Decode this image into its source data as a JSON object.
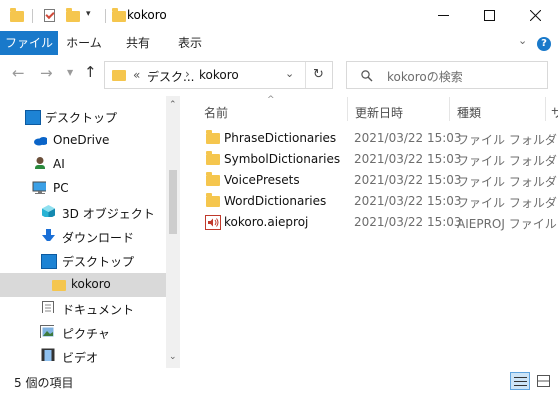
{
  "window": {
    "title": "kokoro"
  },
  "ribbon": {
    "tabs": [
      "ファイル",
      "ホーム",
      "共有",
      "表示"
    ]
  },
  "address": {
    "overflow": "«",
    "crumbs": [
      "デスク...",
      "kokoro"
    ]
  },
  "search": {
    "placeholder": "kokoroの検索"
  },
  "nav": {
    "items": [
      {
        "label": "デスクトップ",
        "icon": "desktop-icon"
      },
      {
        "label": "OneDrive",
        "icon": "cloud-icon"
      },
      {
        "label": "AI",
        "icon": "user-icon"
      },
      {
        "label": "PC",
        "icon": "pc-icon"
      },
      {
        "label": "3D オブジェクト",
        "icon": "cube-icon"
      },
      {
        "label": "ダウンロード",
        "icon": "download-arrow-icon"
      },
      {
        "label": "デスクトップ",
        "icon": "desktop-icon"
      },
      {
        "label": "kokoro",
        "icon": "folder-icon"
      },
      {
        "label": "ドキュメント",
        "icon": "document-icon"
      },
      {
        "label": "ピクチャ",
        "icon": "picture-icon"
      },
      {
        "label": "ビデオ",
        "icon": "film-icon"
      }
    ]
  },
  "columns": {
    "name": "名前",
    "modified": "更新日時",
    "type": "種類",
    "size": "サ"
  },
  "files": [
    {
      "name": "PhraseDictionaries",
      "modified": "2021/03/22 15:03",
      "type": "ファイル フォルダー",
      "icon": "folder-icon"
    },
    {
      "name": "SymbolDictionaries",
      "modified": "2021/03/22 15:03",
      "type": "ファイル フォルダー",
      "icon": "folder-icon"
    },
    {
      "name": "VoicePresets",
      "modified": "2021/03/22 15:03",
      "type": "ファイル フォルダー",
      "icon": "folder-icon"
    },
    {
      "name": "WordDictionaries",
      "modified": "2021/03/22 15:03",
      "type": "ファイル フォルダー",
      "icon": "folder-icon"
    },
    {
      "name": "kokoro.aieproj",
      "modified": "2021/03/22 15:03",
      "type": "AIEPROJ ファイル",
      "icon": "audio-file-icon"
    }
  ],
  "status": {
    "count": "5 個の項目"
  },
  "colors": {
    "accent": "#1979ca",
    "folder": "#f5c64e",
    "selection": "#d9d9d9"
  }
}
